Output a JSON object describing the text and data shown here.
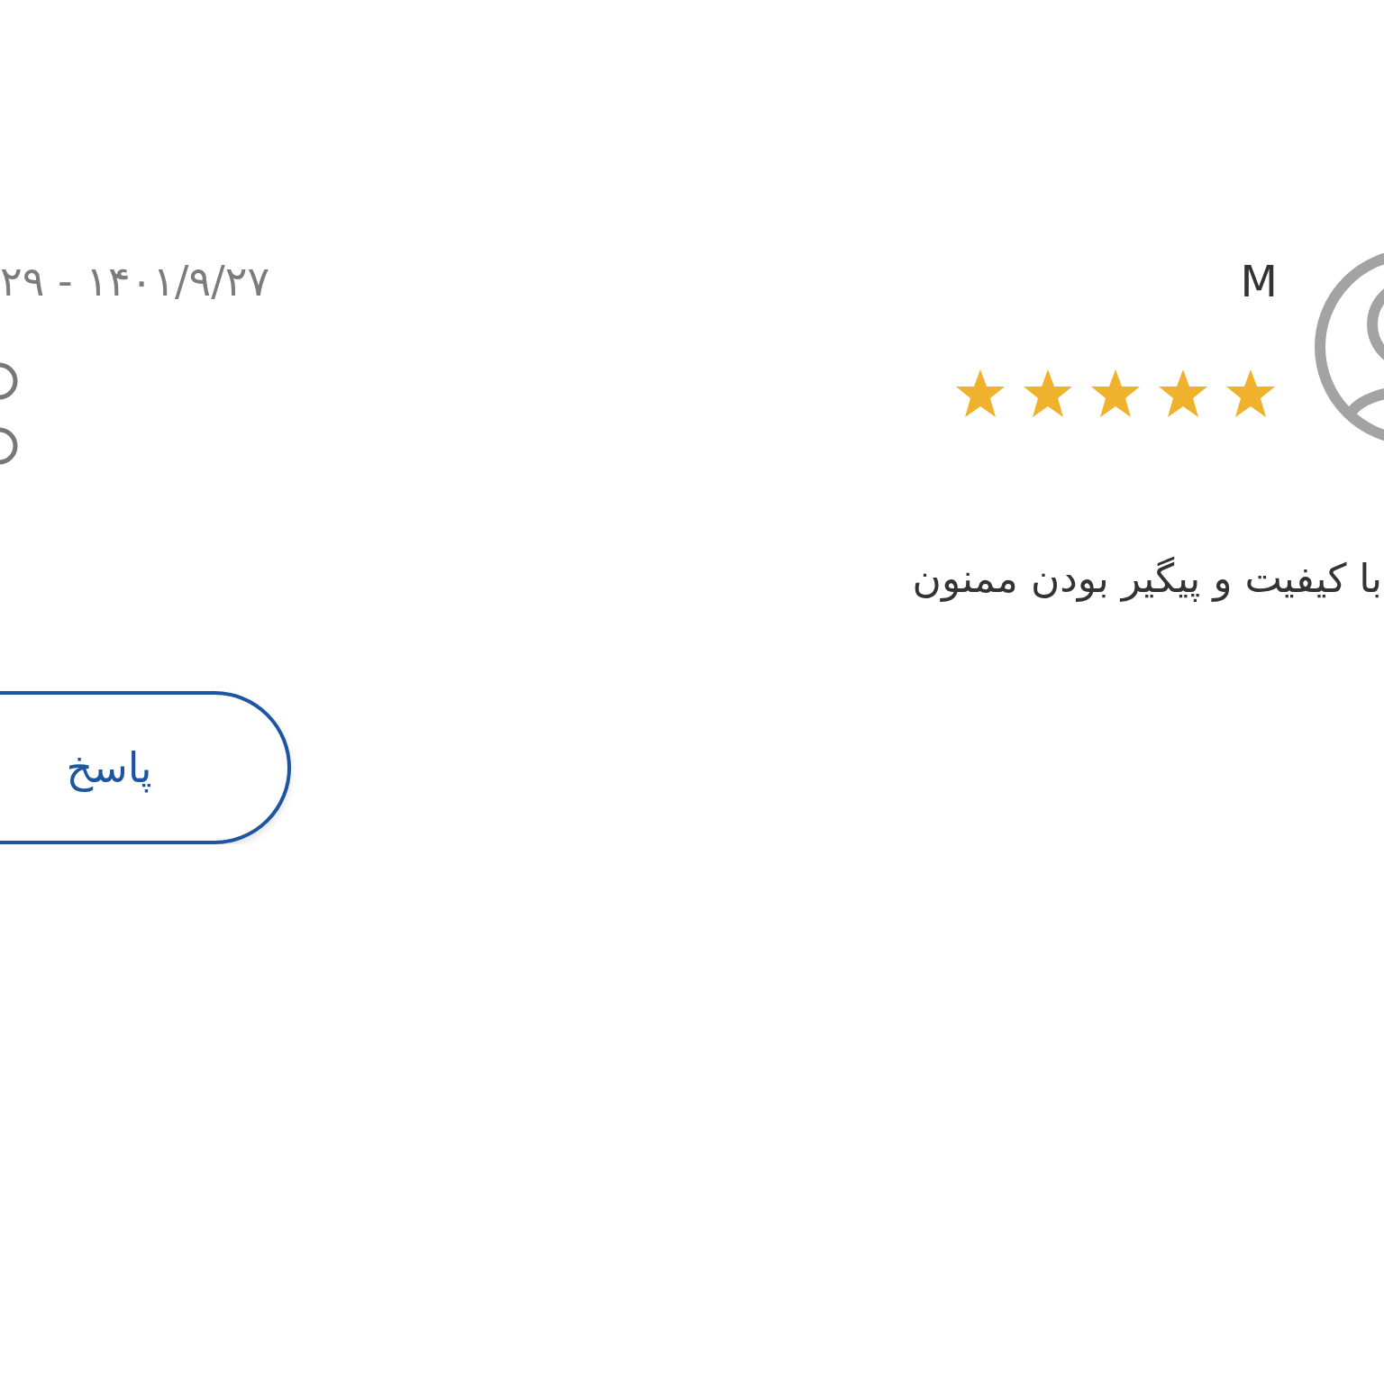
{
  "review": {
    "date": "۲۹ - ۱۴۰۱/۹/۲۷",
    "author": "M",
    "stars": 5,
    "text": "با کیفیت و پیگیر بودن ممنون",
    "reply_button": "پاسخ"
  }
}
